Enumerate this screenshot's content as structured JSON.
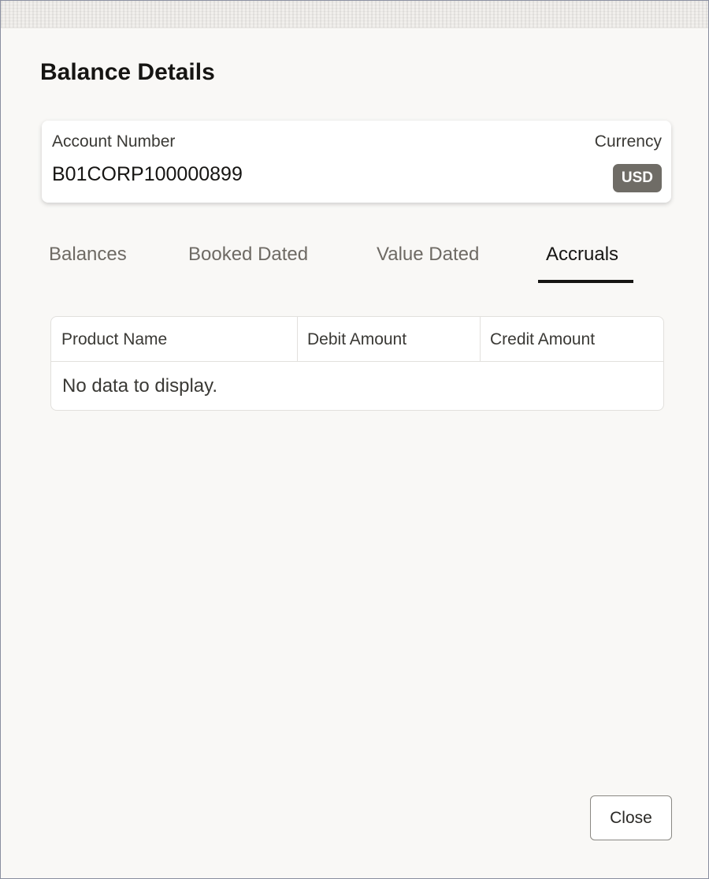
{
  "dialog": {
    "title": "Balance Details"
  },
  "account": {
    "number_label": "Account Number",
    "number_value": "B01CORP100000899",
    "currency_label": "Currency",
    "currency_value": "USD"
  },
  "tabs": [
    {
      "label": "Balances",
      "active": false
    },
    {
      "label": "Booked Dated",
      "active": false
    },
    {
      "label": "Value Dated",
      "active": false
    },
    {
      "label": "Accruals",
      "active": true
    }
  ],
  "table": {
    "columns": [
      "Product Name",
      "Debit Amount",
      "Credit Amount"
    ],
    "rows": [],
    "empty_message": "No data to display."
  },
  "footer": {
    "close_label": "Close"
  },
  "colors": {
    "background": "#f9f8f6",
    "badge": "#6f6c66",
    "active_tab": "#161513",
    "inactive_tab": "#6e6a64"
  }
}
